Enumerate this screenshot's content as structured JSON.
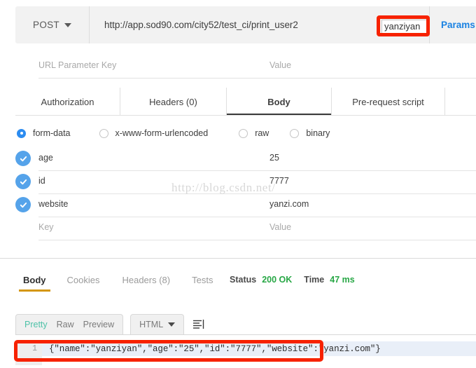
{
  "request_bar": {
    "method": "POST",
    "method_icon": "chevron-down-icon",
    "url": "http://app.sod90.com/city52/test_ci/print_user2",
    "url_variable_value": "yanziyan",
    "params_label": "Params"
  },
  "url_params": {
    "key_placeholder": "URL Parameter Key",
    "value_placeholder": "Value"
  },
  "request_tabs": [
    {
      "label": "Authorization",
      "active": false
    },
    {
      "label": "Headers (0)",
      "active": false
    },
    {
      "label": "Body",
      "active": true
    },
    {
      "label": "Pre-request script",
      "active": false
    }
  ],
  "body_types": [
    {
      "label": "form-data",
      "selected": true
    },
    {
      "label": "x-www-form-urlencoded",
      "selected": false
    },
    {
      "label": "raw",
      "selected": false
    },
    {
      "label": "binary",
      "selected": false
    }
  ],
  "form_data": {
    "rows": [
      {
        "enabled": true,
        "key": "age",
        "value": "25"
      },
      {
        "enabled": true,
        "key": "id",
        "value": "7777"
      },
      {
        "enabled": true,
        "key": "website",
        "value": "yanzi.com"
      }
    ],
    "empty_row": {
      "key_placeholder": "Key",
      "value_placeholder": "Value"
    }
  },
  "watermark": "http://blog.csdn.net/",
  "response_tabs": [
    {
      "label": "Body",
      "active": true
    },
    {
      "label": "Cookies",
      "active": false
    },
    {
      "label": "Headers (8)",
      "active": false
    },
    {
      "label": "Tests",
      "active": false
    }
  ],
  "response_meta": {
    "status_label": "Status",
    "status_value": "200 OK",
    "time_label": "Time",
    "time_value": "47 ms"
  },
  "format_bar": {
    "pretty": "Pretty",
    "raw": "Raw",
    "preview": "Preview",
    "language": "HTML",
    "language_icon": "chevron-down-icon",
    "wrap_icon": "wrap-lines-icon"
  },
  "response_body": {
    "line_number": "1",
    "content": "{\"name\":\"yanziyan\",\"age\":\"25\",\"id\":\"7777\",\"website\":\"yanzi.com\"}"
  },
  "colors": {
    "accent_blue": "#2c8cf0",
    "checkbox_blue": "#55a3ea",
    "status_green": "#27a745",
    "active_tab_underline": "#d4960f",
    "pretty_active": "#4ec2a8",
    "highlight_red": "#f72200",
    "link_blue": "#1a82e2"
  }
}
